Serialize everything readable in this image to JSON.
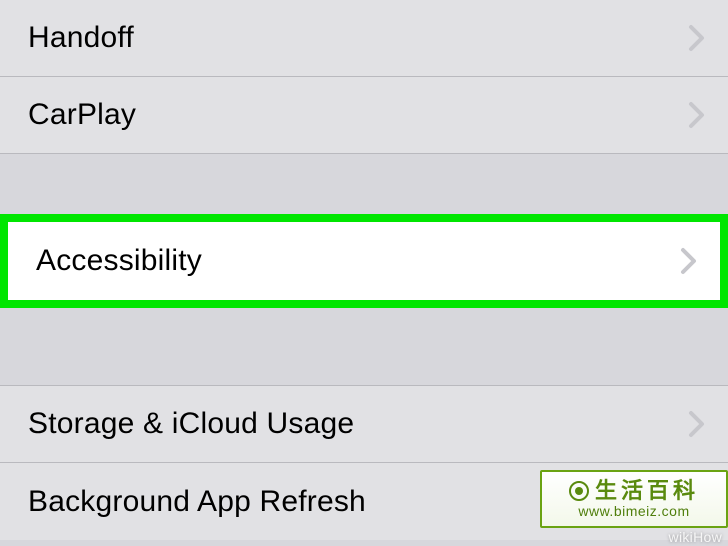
{
  "section1": {
    "items": [
      {
        "label": "Handoff"
      },
      {
        "label": "CarPlay"
      }
    ]
  },
  "highlighted": {
    "label": "Accessibility"
  },
  "section2": {
    "items": [
      {
        "label": "Storage & iCloud Usage"
      },
      {
        "label": "Background App Refresh"
      }
    ]
  },
  "watermark": {
    "title": "生活百科",
    "url": "www.bimeiz.com",
    "corner": "wikiHow"
  },
  "colors": {
    "highlight_border": "#00e600",
    "row_bg": "#e1e1e4",
    "spacer_bg": "#d7d7dc",
    "divider": "#b9b9be",
    "chevron": "#c7c7cc"
  }
}
